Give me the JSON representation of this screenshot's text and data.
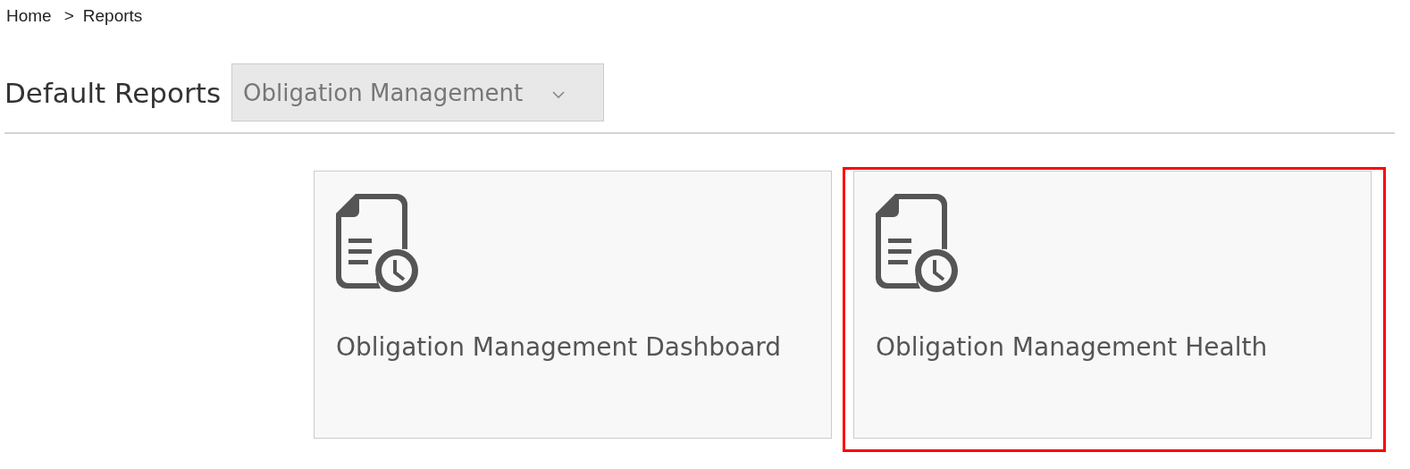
{
  "breadcrumb": [
    {
      "label": "Home"
    },
    {
      "label": "Reports"
    }
  ],
  "breadcrumb_separator": ">",
  "page_title": "Default Reports",
  "report_dropdown": {
    "value": "Obligation Management"
  },
  "cards": [
    {
      "title": "Obligation Management Dashboard",
      "highlighted": false
    },
    {
      "title": "Obligation Management Health",
      "highlighted": true
    }
  ]
}
